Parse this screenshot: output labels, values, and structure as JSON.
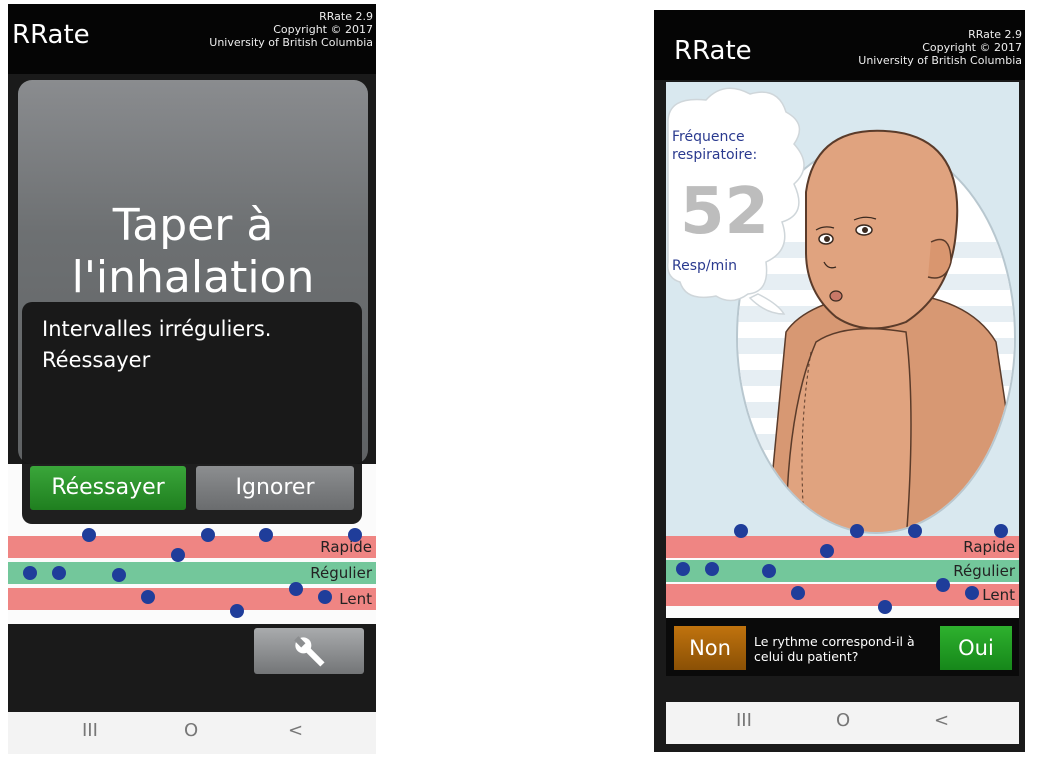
{
  "header": {
    "app_name": "RRate",
    "version": "RRate 2.9",
    "copyright": "Copyright © 2017",
    "institution": "University of British Columbia"
  },
  "screen1": {
    "tap_instruction": "Taper à l'inhalation",
    "dialog_message": "Intervalles irréguliers. Réessayer",
    "retry_button": "Réessayer",
    "ignore_button": "Ignorer",
    "settings_icon": "wrench-icon"
  },
  "screen2": {
    "rate_label": "Fréquence respiratoire:",
    "rate_value": "52",
    "rate_unit": "Resp/min",
    "no_button": "Non",
    "question": "Le rythme correspond-il à celui du patient?",
    "yes_button": "Oui"
  },
  "bands": {
    "fast": "Rapide",
    "regular": "Régulier",
    "slow": "Lent"
  },
  "navbar": {
    "recents": "III",
    "home": "O",
    "back": "<"
  },
  "colors": {
    "band_red": "#ef8583",
    "band_green": "#73c79b",
    "dot": "#1f3d9a",
    "retry_green": "#2a9a2a",
    "non_orange": "#a9620a",
    "oui_green": "#22a022"
  }
}
